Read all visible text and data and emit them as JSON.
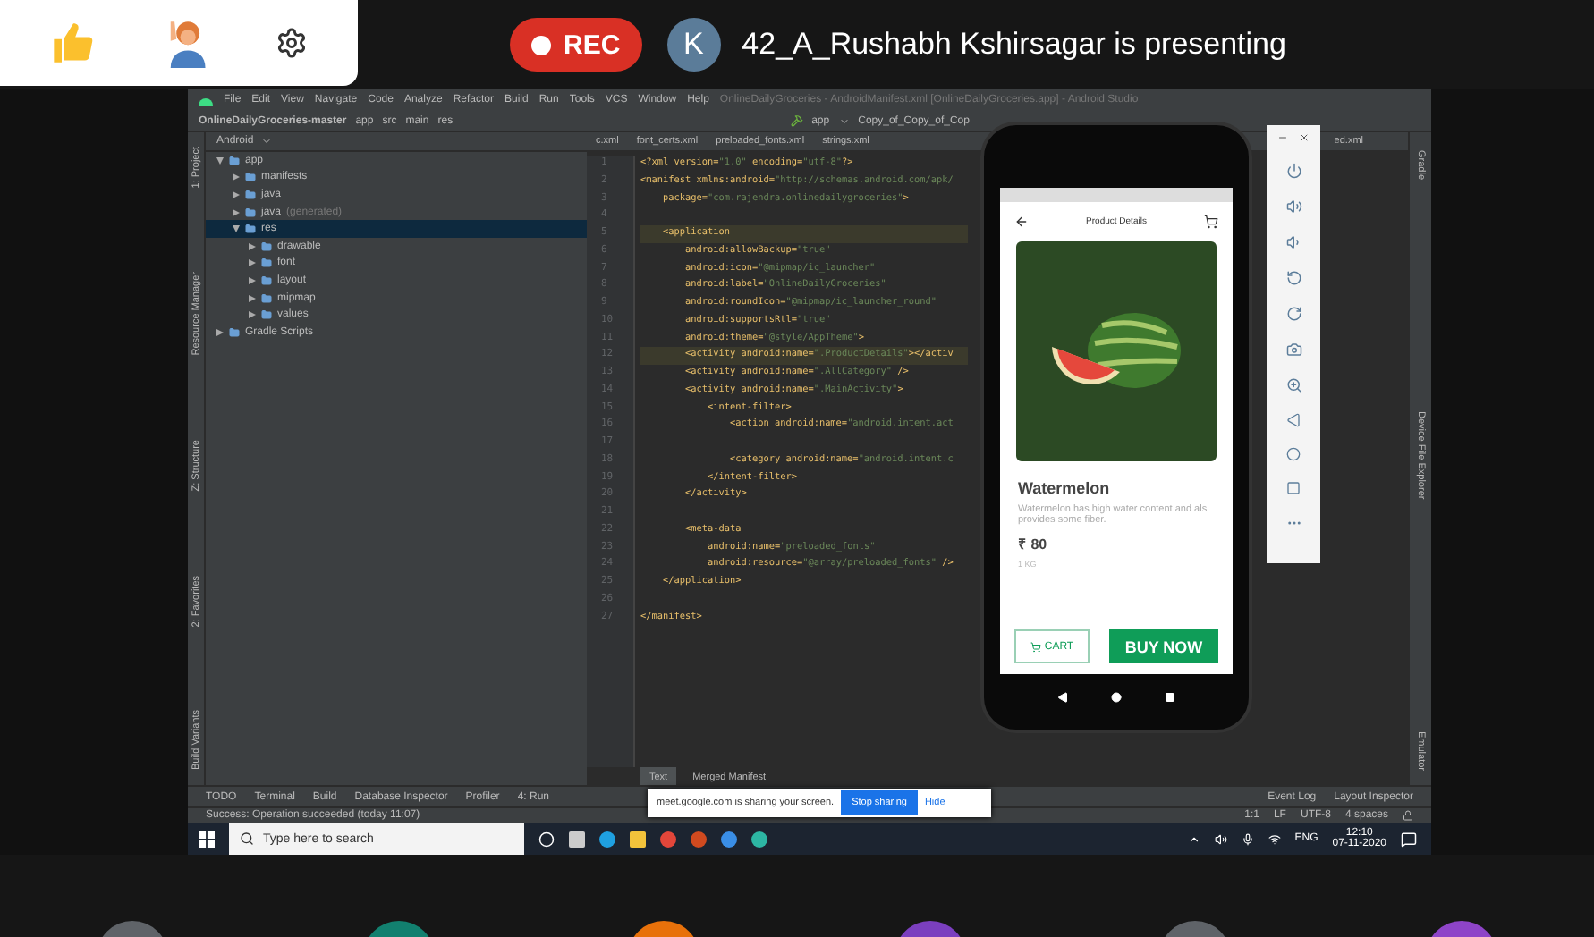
{
  "meet_bar": {
    "rec": "REC",
    "presenter_initial": "K",
    "presenter_text": "42_A_Rushabh Kshirsagar is presenting"
  },
  "ide": {
    "menu": [
      "File",
      "Edit",
      "View",
      "Navigate",
      "Code",
      "Analyze",
      "Refactor",
      "Build",
      "Run",
      "Tools",
      "VCS",
      "Window",
      "Help"
    ],
    "title": "OnlineDailyGroceries - AndroidManifest.xml [OnlineDailyGroceries.app] - Android Studio",
    "breadcrumbs": [
      "OnlineDailyGroceries-master",
      "app",
      "src",
      "main",
      "res"
    ],
    "run_config": "app",
    "device": "Copy_of_Copy_of_Cop",
    "left_tools": [
      "1: Project",
      "Resource Manager",
      "Z: Structure",
      "2: Favorites",
      "Build Variants"
    ],
    "right_tools": [
      "Gradle",
      "Device File Explorer",
      "Emulator"
    ],
    "project_view": "Android",
    "tree": [
      {
        "name": "app",
        "expanded": true,
        "selected": false,
        "children": [
          {
            "name": "manifests",
            "expanded": false,
            "selected": false
          },
          {
            "name": "java",
            "expanded": false,
            "selected": false
          },
          {
            "name": "java",
            "note": "(generated)",
            "expanded": false,
            "selected": false
          },
          {
            "name": "res",
            "expanded": true,
            "selected": true,
            "children": [
              {
                "name": "drawable",
                "expanded": false,
                "selected": false
              },
              {
                "name": "font",
                "expanded": false,
                "selected": false
              },
              {
                "name": "layout",
                "expanded": false,
                "selected": false
              },
              {
                "name": "mipmap",
                "expanded": false,
                "selected": false
              },
              {
                "name": "values",
                "expanded": false,
                "selected": false
              }
            ]
          }
        ]
      },
      {
        "name": "Gradle Scripts",
        "expanded": false,
        "selected": false
      }
    ],
    "tabs": [
      {
        "label": "c.xml",
        "selected": false
      },
      {
        "label": "font_certs.xml",
        "selected": false
      },
      {
        "label": "preloaded_fonts.xml",
        "selected": false
      },
      {
        "label": "strings.xml",
        "selected": false
      },
      {
        "label": "ed.xml",
        "selected": false
      }
    ],
    "code": [
      {
        "n": "1",
        "text": "<?xml version=\"1.0\" encoding=\"utf-8\"?>",
        "highlighted": false
      },
      {
        "n": "2",
        "text": "<manifest xmlns:android=\"http://schemas.android.com/apk/",
        "highlighted": false
      },
      {
        "n": "3",
        "text": "    package=\"com.rajendra.onlinedailygroceries\">",
        "highlighted": false
      },
      {
        "n": "4",
        "highlighted": false
      },
      {
        "n": "5",
        "text": "    <application",
        "highlighted": true
      },
      {
        "n": "6",
        "text": "        android:allowBackup=\"true\"",
        "highlighted": false
      },
      {
        "n": "7",
        "text": "        android:icon=\"@mipmap/ic_launcher\"",
        "highlighted": false
      },
      {
        "n": "8",
        "text": "        android:label=\"OnlineDailyGroceries\"",
        "highlighted": false
      },
      {
        "n": "9",
        "text": "        android:roundIcon=\"@mipmap/ic_launcher_round\"",
        "highlighted": false
      },
      {
        "n": "10",
        "text": "        android:supportsRtl=\"true\"",
        "highlighted": false
      },
      {
        "n": "11",
        "text": "        android:theme=\"@style/AppTheme\">",
        "highlighted": false
      },
      {
        "n": "12",
        "text": "        <activity android:name=\".ProductDetails\"></activ",
        "highlighted": true
      },
      {
        "n": "13",
        "text": "        <activity android:name=\".AllCategory\" />",
        "highlighted": false
      },
      {
        "n": "14",
        "text": "        <activity android:name=\".MainActivity\">",
        "highlighted": false
      },
      {
        "n": "15",
        "text": "            <intent-filter>",
        "highlighted": false
      },
      {
        "n": "16",
        "text": "                <action android:name=\"android.intent.act",
        "highlighted": false
      },
      {
        "n": "17",
        "highlighted": false
      },
      {
        "n": "18",
        "text": "                <category android:name=\"android.intent.c",
        "highlighted": false
      },
      {
        "n": "19",
        "text": "            </intent-filter>",
        "highlighted": false
      },
      {
        "n": "20",
        "text": "        </activity>",
        "highlighted": false
      },
      {
        "n": "21",
        "highlighted": false
      },
      {
        "n": "22",
        "text": "        <meta-data",
        "highlighted": false
      },
      {
        "n": "23",
        "text": "            android:name=\"preloaded_fonts\"",
        "highlighted": false
      },
      {
        "n": "24",
        "text": "            android:resource=\"@array/preloaded_fonts\" />",
        "highlighted": false
      },
      {
        "n": "25",
        "text": "    </application>",
        "highlighted": false
      },
      {
        "n": "26",
        "highlighted": false
      },
      {
        "n": "27",
        "text": "</manifest>",
        "highlighted": false
      }
    ],
    "editor_tabs": [
      {
        "label": "Text",
        "selected": true
      },
      {
        "label": "Merged Manifest",
        "selected": false
      }
    ],
    "tool_tabs": [
      "TODO",
      "Terminal",
      "Build",
      "Database Inspector",
      "Profiler",
      "4: Run"
    ],
    "tool_tabs_right": [
      "Event Log",
      "Layout Inspector"
    ],
    "status": "Success: Operation succeeded (today 11:07)",
    "status_right": [
      "1:1",
      "LF",
      "UTF-8",
      "4 spaces"
    ]
  },
  "phone": {
    "title": "Product Details",
    "product": "Watermelon",
    "description_lines": [
      "Watermelon has high water content and als",
      "provides some fiber."
    ],
    "price": "₹ 80",
    "unit": "1 KG",
    "cart": "CART",
    "buy": "BUY NOW"
  },
  "share_notice": {
    "text": "meet.google.com is sharing your screen.",
    "stop": "Stop sharing",
    "hide": "Hide"
  },
  "taskbar": {
    "search_placeholder": "Type here to search",
    "lang": "ENG",
    "time": "12:10",
    "date": "07-11-2020"
  },
  "participants": [
    {
      "color": "#5f6368"
    },
    {
      "color": "#12806f"
    },
    {
      "color": "#e8710a"
    },
    {
      "color": "#7b3fbf"
    },
    {
      "color": "#5f6368"
    },
    {
      "color": "#8e44c8"
    }
  ]
}
